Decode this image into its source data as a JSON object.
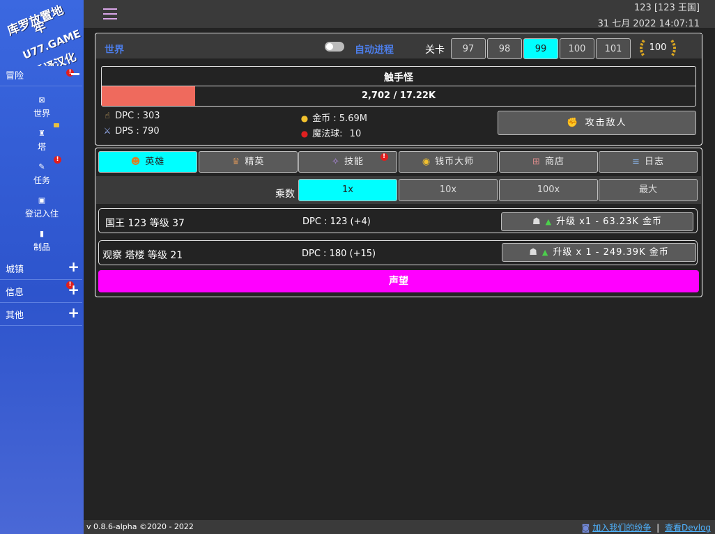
{
  "logo": {
    "line1": "库罗放置地",
    "line2": "牢",
    "line3": "U77.GAME",
    "line4": "乐译汉化"
  },
  "sidebar": {
    "sections": [
      {
        "label": "冒险",
        "badge": "!",
        "expanded": true
      },
      {
        "label": "城镇",
        "badge": "",
        "expanded": false
      },
      {
        "label": "信息",
        "badge": "!",
        "expanded": false
      },
      {
        "label": "其他",
        "badge": "",
        "expanded": false
      }
    ],
    "adventure_items": [
      {
        "label": "世界",
        "icon": "map-icon",
        "glyph": "⊠"
      },
      {
        "label": "塔",
        "icon": "tower-icon",
        "glyph": "♜",
        "locked": true
      },
      {
        "label": "任务",
        "icon": "quest-icon",
        "glyph": "✎",
        "badge": "!"
      },
      {
        "label": "登记入住",
        "icon": "checkin-icon",
        "glyph": "▣"
      },
      {
        "label": "制品",
        "icon": "artifact-book-icon",
        "glyph": "▮"
      }
    ]
  },
  "header": {
    "kingdom": "123  [123 王国]",
    "datetime": "31 七月 2022  14:07:11"
  },
  "world": {
    "title": "世界",
    "auto_progress_label": "自动进程",
    "auto_progress_on": false,
    "stage_label": "关卡",
    "stages": [
      "97",
      "98",
      "99",
      "100",
      "101"
    ],
    "active_stage": "99",
    "max_stage": "100",
    "monster_name": "触手怪",
    "hp_text": "2,702 / 17.22K",
    "hp_fraction": 0.157,
    "dpc": "DPC : 303",
    "dps": "DPS : 790",
    "gold": "金币 : 5.69M",
    "orbs_label": "魔法球:",
    "orbs_value": "10",
    "attack_label": "攻击敌人"
  },
  "tabs": [
    {
      "label": "英雄",
      "icon": "hero-icon",
      "glyph": "☻",
      "active": true
    },
    {
      "label": "精英",
      "icon": "elite-icon",
      "glyph": "♛"
    },
    {
      "label": "技能",
      "icon": "skill-icon",
      "glyph": "✧",
      "badge": "!"
    },
    {
      "label": "钱币大师",
      "icon": "coins-icon",
      "glyph": "◉"
    },
    {
      "label": "商店",
      "icon": "shop-basket-icon",
      "glyph": "⊞"
    },
    {
      "label": "日志",
      "icon": "log-icon",
      "glyph": "≡"
    }
  ],
  "multiplier": {
    "label": "乘数",
    "options": [
      "1x",
      "10x",
      "100x",
      "最大"
    ],
    "active": "1x"
  },
  "heroes": [
    {
      "name": "国王 123 等级 37",
      "dpc": "DPC : 123 (+4)",
      "upgrade": "升级 x1 - 63.23K 金币"
    },
    {
      "name": "观察 塔楼 等级 21",
      "dpc": "DPC : 180 (+15)",
      "upgrade": "升级 x 1 - 249.39K 金币"
    }
  ],
  "reputation_label": "声望",
  "footer": {
    "version": "v 0.8.6-alpha  ©2020 - 2022",
    "discord": "加入我们的纷争",
    "separator": "|",
    "devlog": "查看Devlog"
  },
  "colors": {
    "accent_cyan": "#00ffff",
    "prestige_magenta": "#ff00ff",
    "hp_red": "#ef6a5d",
    "sidebar_blue": "#3b68e0",
    "link_blue": "#4c7de8"
  }
}
